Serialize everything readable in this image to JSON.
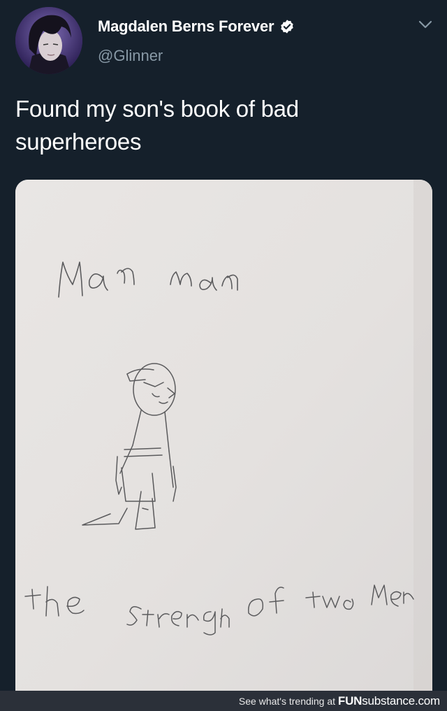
{
  "tweet": {
    "display_name": "Magdalen Berns Forever",
    "handle": "@Glinner",
    "text_line1": "Found my son's book of bad",
    "text_line2": "superheroes",
    "verified": true
  },
  "drawing": {
    "title": "Man man",
    "caption": "the strength of two men"
  },
  "footer": {
    "prefix": "See what's trending at ",
    "brand_bold": "FUN",
    "brand_rest": "substance",
    "brand_tld": ".com"
  },
  "colors": {
    "background": "#15202b",
    "handle": "#8899a6",
    "footer_bg": "#2b3039",
    "paper": "#e6e3e1"
  },
  "icons": {
    "verified": "verified-badge-icon",
    "menu": "chevron-down-icon"
  }
}
